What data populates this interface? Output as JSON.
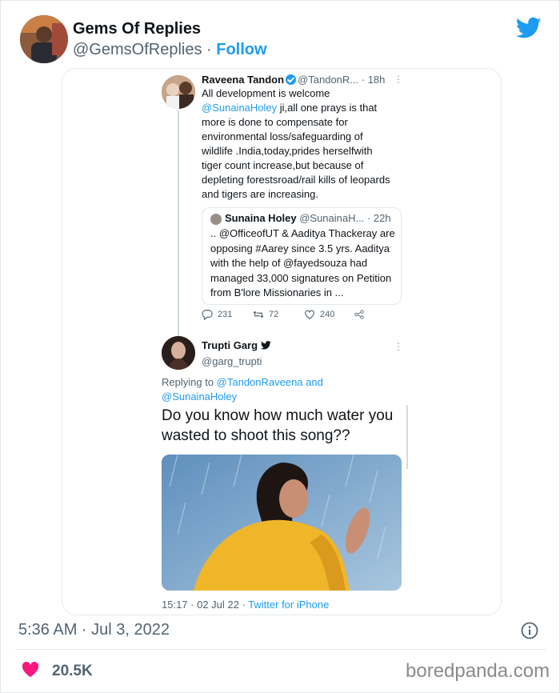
{
  "post": {
    "author_name": "Gems Of Replies",
    "author_handle": "@GemsOfReplies",
    "separator": " · ",
    "follow_label": "Follow",
    "timestamp": "5:36 AM · Jul 3, 2022",
    "likes": "20.5K"
  },
  "screenshot": {
    "retweet": {
      "name": "Raveena Tandon",
      "handle": "@TandonR...",
      "time": "· 18h",
      "text_before_mention": "All development is welcome ",
      "mention": "@SunainaHoley",
      "text_after_mention": " ji,all one prays is that more is done to compensate for environmental loss/safeguarding of wildlife .India,today,prides herselfwith tiger count increase,but because of depleting forestsroad/rail kills of leopards and tigers are increasing.",
      "quote": {
        "name": "Sunaina Holey",
        "handle": "@SunainaH...",
        "time": "· 22h",
        "text": ".. @OfficeofUT & Aaditya Thackeray are opposing #Aarey since 3.5 yrs. Aaditya with the help of @fayedsouza had managed 33,000 signatures on Petition from B'lore Missionaries in ..."
      },
      "replies": "231",
      "retweets": "72",
      "likes": "240"
    },
    "reply": {
      "name": "Trupti Garg",
      "handle": "@garg_trupti",
      "replying_prefix": "Replying to ",
      "replying_to_1": "@TandonRaveena",
      "replying_and": " and ",
      "replying_to_2": "@SunainaHoley",
      "text": "Do you know how much water you wasted to shoot this song??",
      "meta_time": "15:17 · 02 Jul 22 · ",
      "meta_source": "Twitter for iPhone"
    }
  },
  "watermark": "boredpanda.com",
  "icons": [
    "twitter-bird-icon",
    "verified-badge-icon",
    "reply-icon",
    "retweet-icon",
    "like-icon",
    "share-icon",
    "more-icon",
    "info-icon",
    "heart-icon"
  ],
  "colors": {
    "accent": "#1d9bf0",
    "heart": "#f91880",
    "muted": "#536471"
  }
}
